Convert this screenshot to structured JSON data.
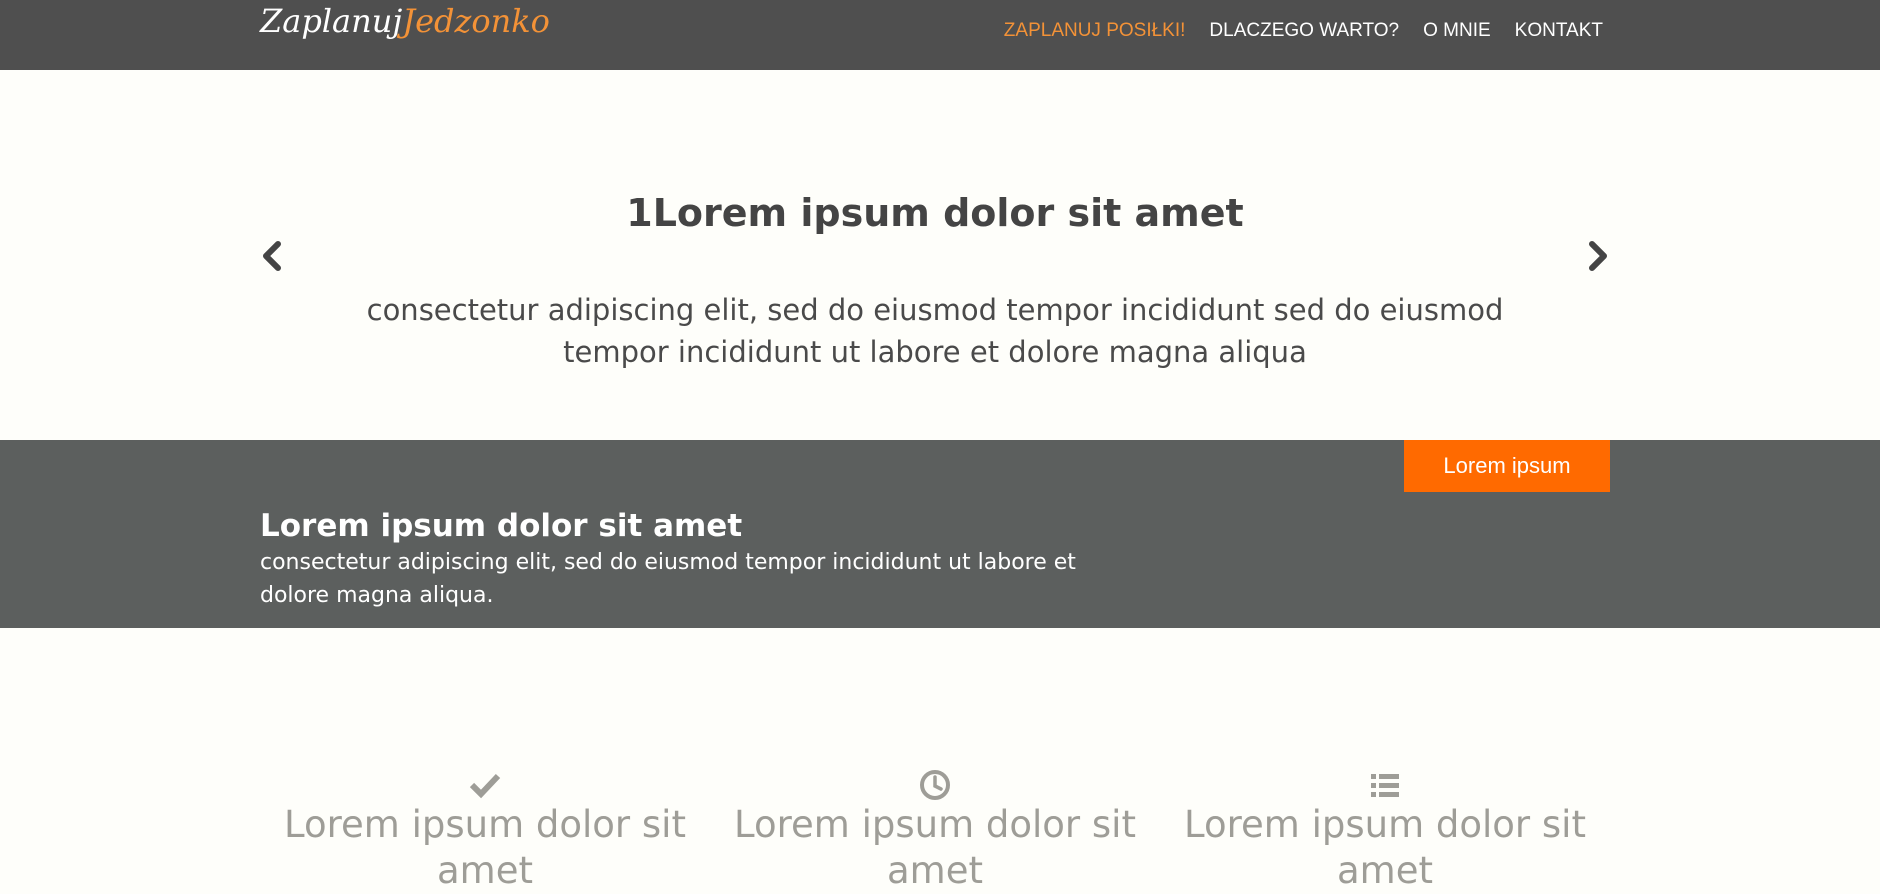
{
  "brand": {
    "part1": "Zaplanuj",
    "part2": "Jedzonko"
  },
  "nav": {
    "items": [
      {
        "label": "ZAPLANUJ POSIŁKI!",
        "active": true
      },
      {
        "label": "DLACZEGO WARTO?",
        "active": false
      },
      {
        "label": "O MNIE",
        "active": false
      },
      {
        "label": "KONTAKT",
        "active": false
      }
    ]
  },
  "slider": {
    "title": "1Lorem ipsum dolor sit amet",
    "text": "consectetur adipiscing elit, sed do eiusmod tempor incididunt sed do eiusmod tempor incididunt ut labore et dolore magna aliqua",
    "prev_icon": "chevron-left-icon",
    "next_icon": "chevron-right-icon"
  },
  "band": {
    "title": "Lorem ipsum dolor sit amet",
    "text": "consectetur adipiscing elit, sed do eiusmod tempor incididunt ut labore et dolore magna aliqua.",
    "button_label": "Lorem ipsum"
  },
  "features": [
    {
      "icon": "check-icon",
      "title": "Lorem ipsum dolor sit amet"
    },
    {
      "icon": "clock-icon",
      "title": "Lorem ipsum dolor sit amet"
    },
    {
      "icon": "list-icon",
      "title": "Lorem ipsum dolor sit amet"
    }
  ],
  "colors": {
    "navbar_bg": "#4f4f4f",
    "accent": "#f39237",
    "band_bg": "#5c5f5e",
    "button_bg": "#ff6a00",
    "page_bg": "#fefefa",
    "feature_text": "#9e9d97"
  }
}
